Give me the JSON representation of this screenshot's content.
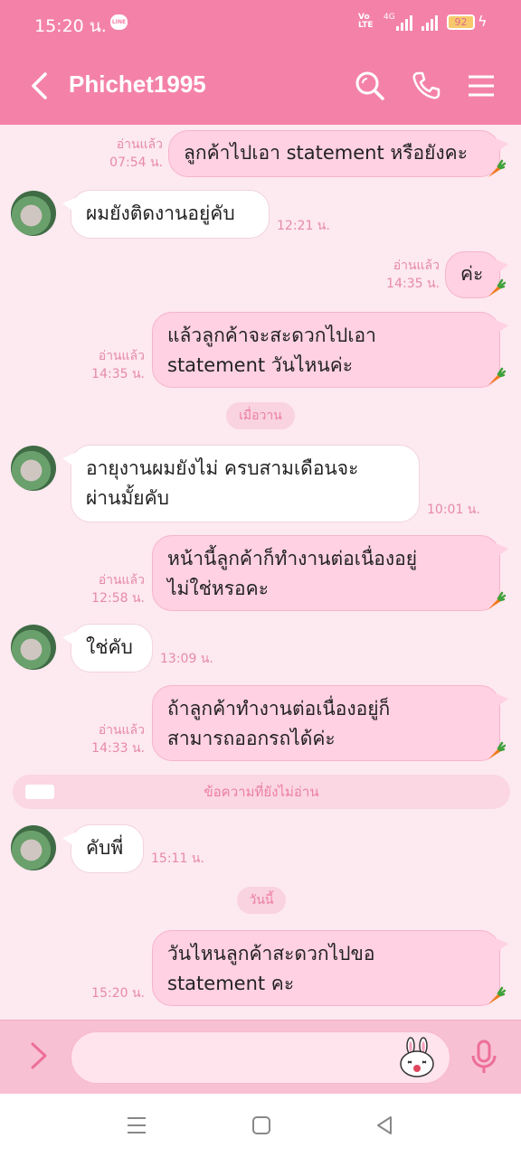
{
  "status": {
    "time": "15:20 น.",
    "app_badge": "LINE",
    "network": "VoLTE",
    "net_type": "4G",
    "battery": "92",
    "colors": {
      "bar": "#f482a8"
    }
  },
  "header": {
    "title": "Phichet1995",
    "icons": [
      "back-icon",
      "search-icon",
      "phone-icon",
      "menu-icon"
    ]
  },
  "messages": [
    {
      "text": "ลูกค้าไปเอา statement หรือยังคะ",
      "read": "อ่านแล้ว",
      "time": "07:54 น."
    },
    {
      "text": "ผมยังติดงานอยู่คับ",
      "time": "12:21 น."
    },
    {
      "text": "ค่ะ",
      "read": "อ่านแล้ว",
      "time": "14:35 น."
    },
    {
      "lines": [
        "แล้วลูกค้าจะสะดวกไปเอา",
        "statement วันไหนค่ะ"
      ],
      "read": "อ่านแล้ว",
      "time": "14:35 น."
    },
    {
      "lines": [
        "อายุงานผมยังไม่ ครบสามเดือนจะ",
        "ผ่านมั้ยคับ"
      ],
      "time": "10:01 น."
    },
    {
      "lines": [
        "หน้านี้ลูกค้าก็ทำงานต่อเนื่องอยู่",
        "ไม่ใช่หรอคะ"
      ],
      "read": "อ่านแล้ว",
      "time": "12:58 น."
    },
    {
      "text": "ใช่คับ",
      "time": "13:09 น."
    },
    {
      "lines": [
        "ถ้าลูกค้าทำงานต่อเนื่องอยู่ก็",
        "สามารถออกรถได้ค่ะ"
      ],
      "read": "อ่านแล้ว",
      "time": "14:33 น."
    },
    {
      "text": "คับพี่",
      "time": "15:11 น."
    },
    {
      "lines": [
        "วันไหนลูกค้าสะดวกไปขอ",
        "statement คะ"
      ],
      "time": "15:20 น."
    }
  ],
  "dividers": {
    "yesterday": "เมื่อวาน",
    "unread": "ข้อความที่ยังไม่อ่าน",
    "today": "วันนี้"
  },
  "input": {
    "placeholder": "",
    "icons": [
      "expand-icon",
      "sticker-icon",
      "mic-icon"
    ]
  },
  "navbar": {
    "icons": [
      "recents-icon",
      "home-icon",
      "back-nav-icon"
    ]
  },
  "colors": {
    "accent": "#f482a8",
    "chat_bg": "#fde9f0",
    "outgoing_bubble": "#ffd1e2",
    "incoming_bubble": "#ffffff",
    "meta_text": "#e68aa8"
  }
}
